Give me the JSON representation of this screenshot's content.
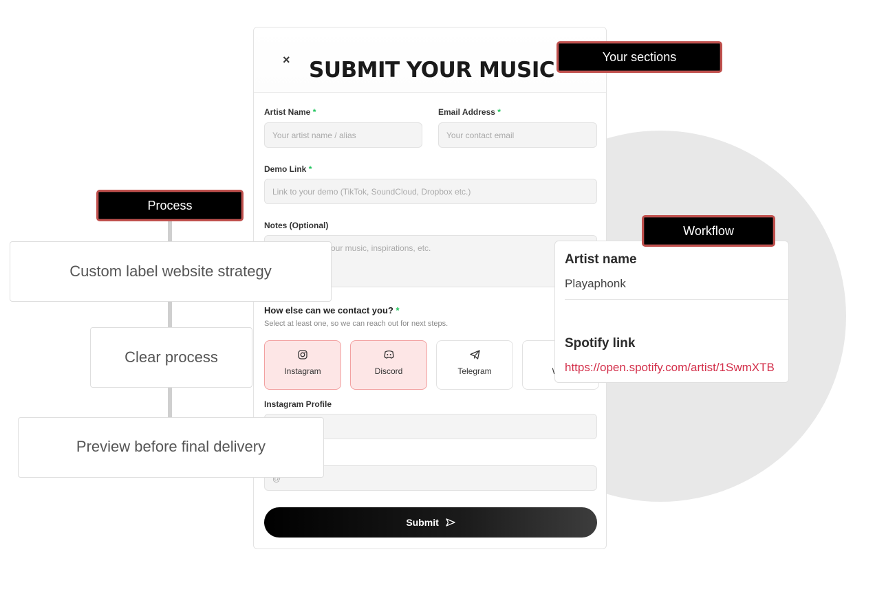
{
  "form": {
    "title": "SUBMIT YOUR MUSIC",
    "close_glyph": "×",
    "artist_name": {
      "label": "Artist Name",
      "required": "*",
      "placeholder": "Your artist name / alias"
    },
    "email": {
      "label": "Email Address",
      "required": "*",
      "placeholder": "Your contact email"
    },
    "demo_link": {
      "label": "Demo Link",
      "required": "*",
      "placeholder": "Link to your demo (TikTok, SoundCloud, Dropbox etc.)"
    },
    "notes": {
      "label": "Notes (Optional)",
      "placeholder": "our music, inspirations, etc."
    },
    "contact": {
      "question": "How else can we contact you?",
      "required": "*",
      "subtitle": "Select at least one, so we can reach out for next steps.",
      "options": [
        {
          "label": "Instagram",
          "icon": "instagram-icon",
          "selected": true
        },
        {
          "label": "Discord",
          "icon": "discord-icon",
          "selected": true
        },
        {
          "label": "Telegram",
          "icon": "telegram-icon",
          "selected": false
        },
        {
          "label": "Wha",
          "icon": "whatsapp-icon",
          "selected": false
        }
      ]
    },
    "instagram_profile": {
      "label": "Instagram Profile",
      "value": ""
    },
    "discord_field": {
      "value": "@"
    },
    "submit_label": "Submit",
    "submit_icon": "send-icon"
  },
  "tags": {
    "sections": "Your sections",
    "process": "Process",
    "workflow": "Workflow"
  },
  "process_steps": [
    "Custom label website strategy",
    "Clear process",
    "Preview before final delivery"
  ],
  "workflow_card": {
    "artist_heading": "Artist name",
    "artist_value": "Playaphonk",
    "spotify_heading": "Spotify link",
    "spotify_value": "https://open.spotify.com/artist/1SwmXTB"
  },
  "colors": {
    "accent_red": "#c0504d",
    "required_green": "#22c55e",
    "link_red": "#d32f4a",
    "selected_bg": "#fde6e6"
  }
}
